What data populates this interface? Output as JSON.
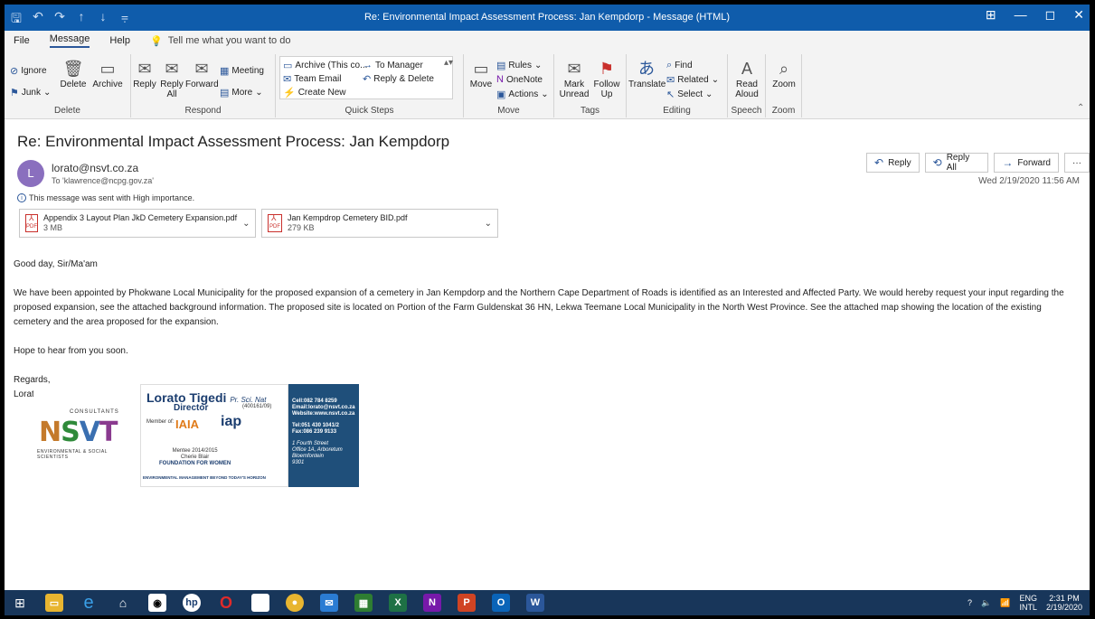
{
  "window": {
    "title": "Re: Environmental Impact Assessment Process: Jan Kempdorp - Message (HTML)",
    "controls": [
      "⊞",
      "—",
      "◻",
      "✕"
    ]
  },
  "menu": {
    "tabs": [
      "File",
      "Message",
      "Help"
    ],
    "active": "Message",
    "tell": "Tell me what you want to do"
  },
  "ribbon": {
    "delete": {
      "label": "Delete",
      "ignore": "Ignore",
      "junk": "Junk",
      "delete_btn": "Delete",
      "archive": "Archive"
    },
    "respond": {
      "label": "Respond",
      "reply": "Reply",
      "reply_all": "Reply All",
      "forward": "Forward",
      "meeting": "Meeting",
      "more": "More"
    },
    "quick_steps": {
      "label": "Quick Steps",
      "archive_this": "Archive (This co...",
      "to_manager": "To Manager",
      "team_email": "Team Email",
      "reply_delete": "Reply & Delete",
      "create_new": "Create New"
    },
    "move": {
      "label": "Move",
      "move_btn": "Move",
      "rules": "Rules",
      "onenote": "OneNote",
      "actions": "Actions"
    },
    "tags": {
      "label": "Tags",
      "mark_unread": "Mark Unread",
      "follow_up": "Follow Up"
    },
    "editing": {
      "label": "Editing",
      "translate": "Translate",
      "find": "Find",
      "related": "Related",
      "select": "Select"
    },
    "speech": {
      "label": "Speech",
      "read_aloud": "Read Aloud"
    },
    "zoom": {
      "label": "Zoom",
      "zoom_btn": "Zoom"
    }
  },
  "message": {
    "subject": "Re: Environmental Impact Assessment Process: Jan Kempdorp",
    "avatar_initial": "L",
    "from": "lorato@nsvt.co.za",
    "to": "To  'klawrence@ncpg.gov.za'",
    "importance": "This message was sent with High importance.",
    "date": "Wed 2/19/2020 11:56 AM",
    "actions": {
      "reply": "Reply",
      "reply_all": "Reply All",
      "forward": "Forward",
      "more": "···"
    },
    "attachments": [
      {
        "name": "Appendix 3 Layout Plan JkD Cemetery Expansion.pdf",
        "size": "3 MB"
      },
      {
        "name": "Jan Kempdrop Cemetery BID.pdf",
        "size": "279 KB"
      }
    ],
    "body": {
      "greeting": "Good day, Sir/Ma'am",
      "para1": "We have been appointed by Phokwane Local Municipality for the proposed expansion of a cemetery in Jan Kempdorp and the Northern Cape Department of Roads is identified as an Interested and Affected Party. We would hereby request your input regarding the proposed expansion, see the attached background information.  The proposed site is located on Portion of the Farm Guldenskat 36 HN, Lekwa Teemane Local Municipality in the North West Province.  See the attached map showing the location of the existing cemetery and the area proposed for the expansion.",
      "para2": "Hope to hear from you soon.",
      "closing": "Regards,",
      "name": "Lorato"
    }
  },
  "signature": {
    "consultants": "CONSULTANTS",
    "logo_letters": [
      "N",
      "S",
      "V",
      "T"
    ],
    "env": "ENVIRONMENTAL & SOCIAL SCIENTISTS",
    "name": "Lorato Tigedi",
    "title_suffix": "Pr. Sci. Nat",
    "role": "Director",
    "reg": "(400161/09)",
    "member": "Member of:",
    "iaia": "IAIA",
    "iap": "iap",
    "mentee1": "Mentee 2014/2015",
    "mentee2": "Cherie Blair",
    "mentee3": "FOUNDATION FOR WOMEN",
    "slogan": "ENVIRONMENTAL MANAGEMENT BEYOND TODAY'S HORIZON",
    "cell": "Cell:082 784 8259",
    "email": "Email:lorato@nsvt.co.za",
    "website": "Website:www.nsvt.co.za",
    "tel": "Tel:051 430 1041/2",
    "fax": "Fax:086 239 9133",
    "addr1": "1 Fourth Street",
    "addr2": "Office 1A, Arboretum",
    "addr3": "Bloemfontein",
    "addr4": "9301"
  },
  "taskbar": {
    "lang": "ENG",
    "lang2": "INTL",
    "time": "2:31 PM",
    "date": "2/19/2020"
  }
}
